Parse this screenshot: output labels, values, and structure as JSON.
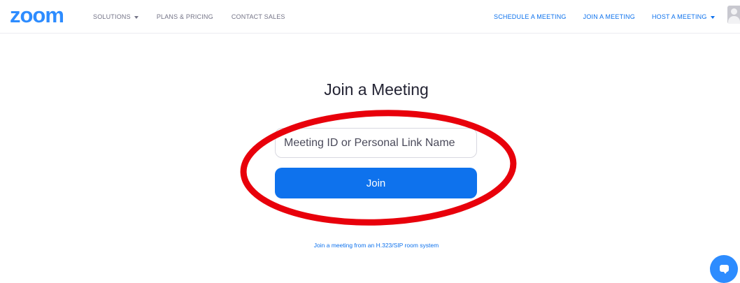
{
  "brand": {
    "logo_text": "zoom",
    "accent": "#2d8cff",
    "link_color": "#0e72ed"
  },
  "nav": {
    "left": [
      {
        "label": "SOLUTIONS",
        "has_dropdown": true
      },
      {
        "label": "PLANS & PRICING",
        "has_dropdown": false
      },
      {
        "label": "CONTACT SALES",
        "has_dropdown": false
      }
    ],
    "right": [
      {
        "label": "SCHEDULE A MEETING",
        "has_dropdown": false
      },
      {
        "label": "JOIN A MEETING",
        "has_dropdown": false
      },
      {
        "label": "HOST A MEETING",
        "has_dropdown": true
      }
    ],
    "avatar_icon": "user-avatar-icon"
  },
  "main": {
    "title": "Join a Meeting",
    "meeting_input": {
      "value": "",
      "placeholder": "Meeting ID or Personal Link Name"
    },
    "join_label": "Join",
    "sip_link": "Join a meeting from an H.323/SIP room system"
  },
  "annotation": {
    "shape": "ellipse",
    "color": "#e8000b"
  },
  "chat_button": {
    "icon": "chat-bubble-icon"
  }
}
